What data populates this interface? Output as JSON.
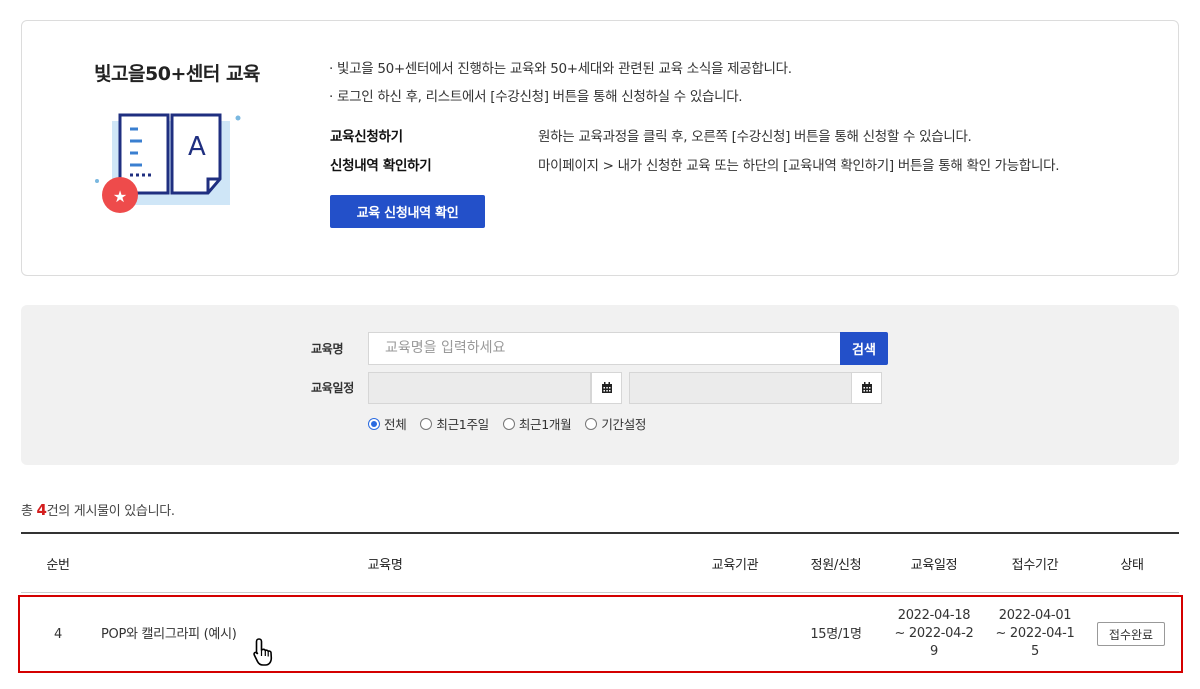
{
  "info": {
    "title": "빛고을50+센터 교육",
    "line1": "· 빛고을 50+센터에서 진행하는 교육와 50+세대와 관련된 교육 소식을 제공합니다.",
    "line2": "· 로그인 하신 후, 리스트에서 [수강신청] 버튼을 통해 신청하실 수 있습니다.",
    "rows": [
      {
        "key": "교육신청하기",
        "value": "원하는 교육과정을 클릭 후, 오른쪽 [수강신청] 버튼을 통해 신청할 수 있습니다."
      },
      {
        "key": "신청내역 확인하기",
        "value": "마이페이지 > 내가 신청한 교육 또는 하단의 [교육내역 확인하기] 버튼을 통해 확인 가능합니다."
      }
    ],
    "history_button": "교육 신청내역 확인",
    "illus_letter": "A"
  },
  "search": {
    "name_label": "교육명",
    "name_placeholder": "교육명을 입력하세요",
    "search_button": "검색",
    "date_label": "교육일정",
    "radios": [
      {
        "label": "전체",
        "selected": true
      },
      {
        "label": "최근1주일",
        "selected": false
      },
      {
        "label": "최근1개월",
        "selected": false
      },
      {
        "label": "기간설정",
        "selected": false
      }
    ]
  },
  "summary": {
    "prefix": "총 ",
    "count": "4",
    "suffix": "건의 게시물이 있습니다."
  },
  "table": {
    "headers": {
      "no": "순번",
      "name": "교육명",
      "org": "교육기관",
      "cap": "정원/신청",
      "schedule": "교육일정",
      "period": "접수기간",
      "status": "상태"
    },
    "rows": [
      {
        "no": "4",
        "name": "POP와 캘리그라피 (예시)",
        "org": "",
        "cap": "15명/1명",
        "schedule_l1": "2022-04-18",
        "schedule_l2": "~ 2022-04-2",
        "schedule_l3": "9",
        "period_l1": "2022-04-01",
        "period_l2": "~ 2022-04-1",
        "period_l3": "5",
        "status": "접수완료"
      }
    ]
  },
  "colors": {
    "accent": "#2350c9",
    "count": "#d41e1e",
    "highlight": "#d40000"
  }
}
